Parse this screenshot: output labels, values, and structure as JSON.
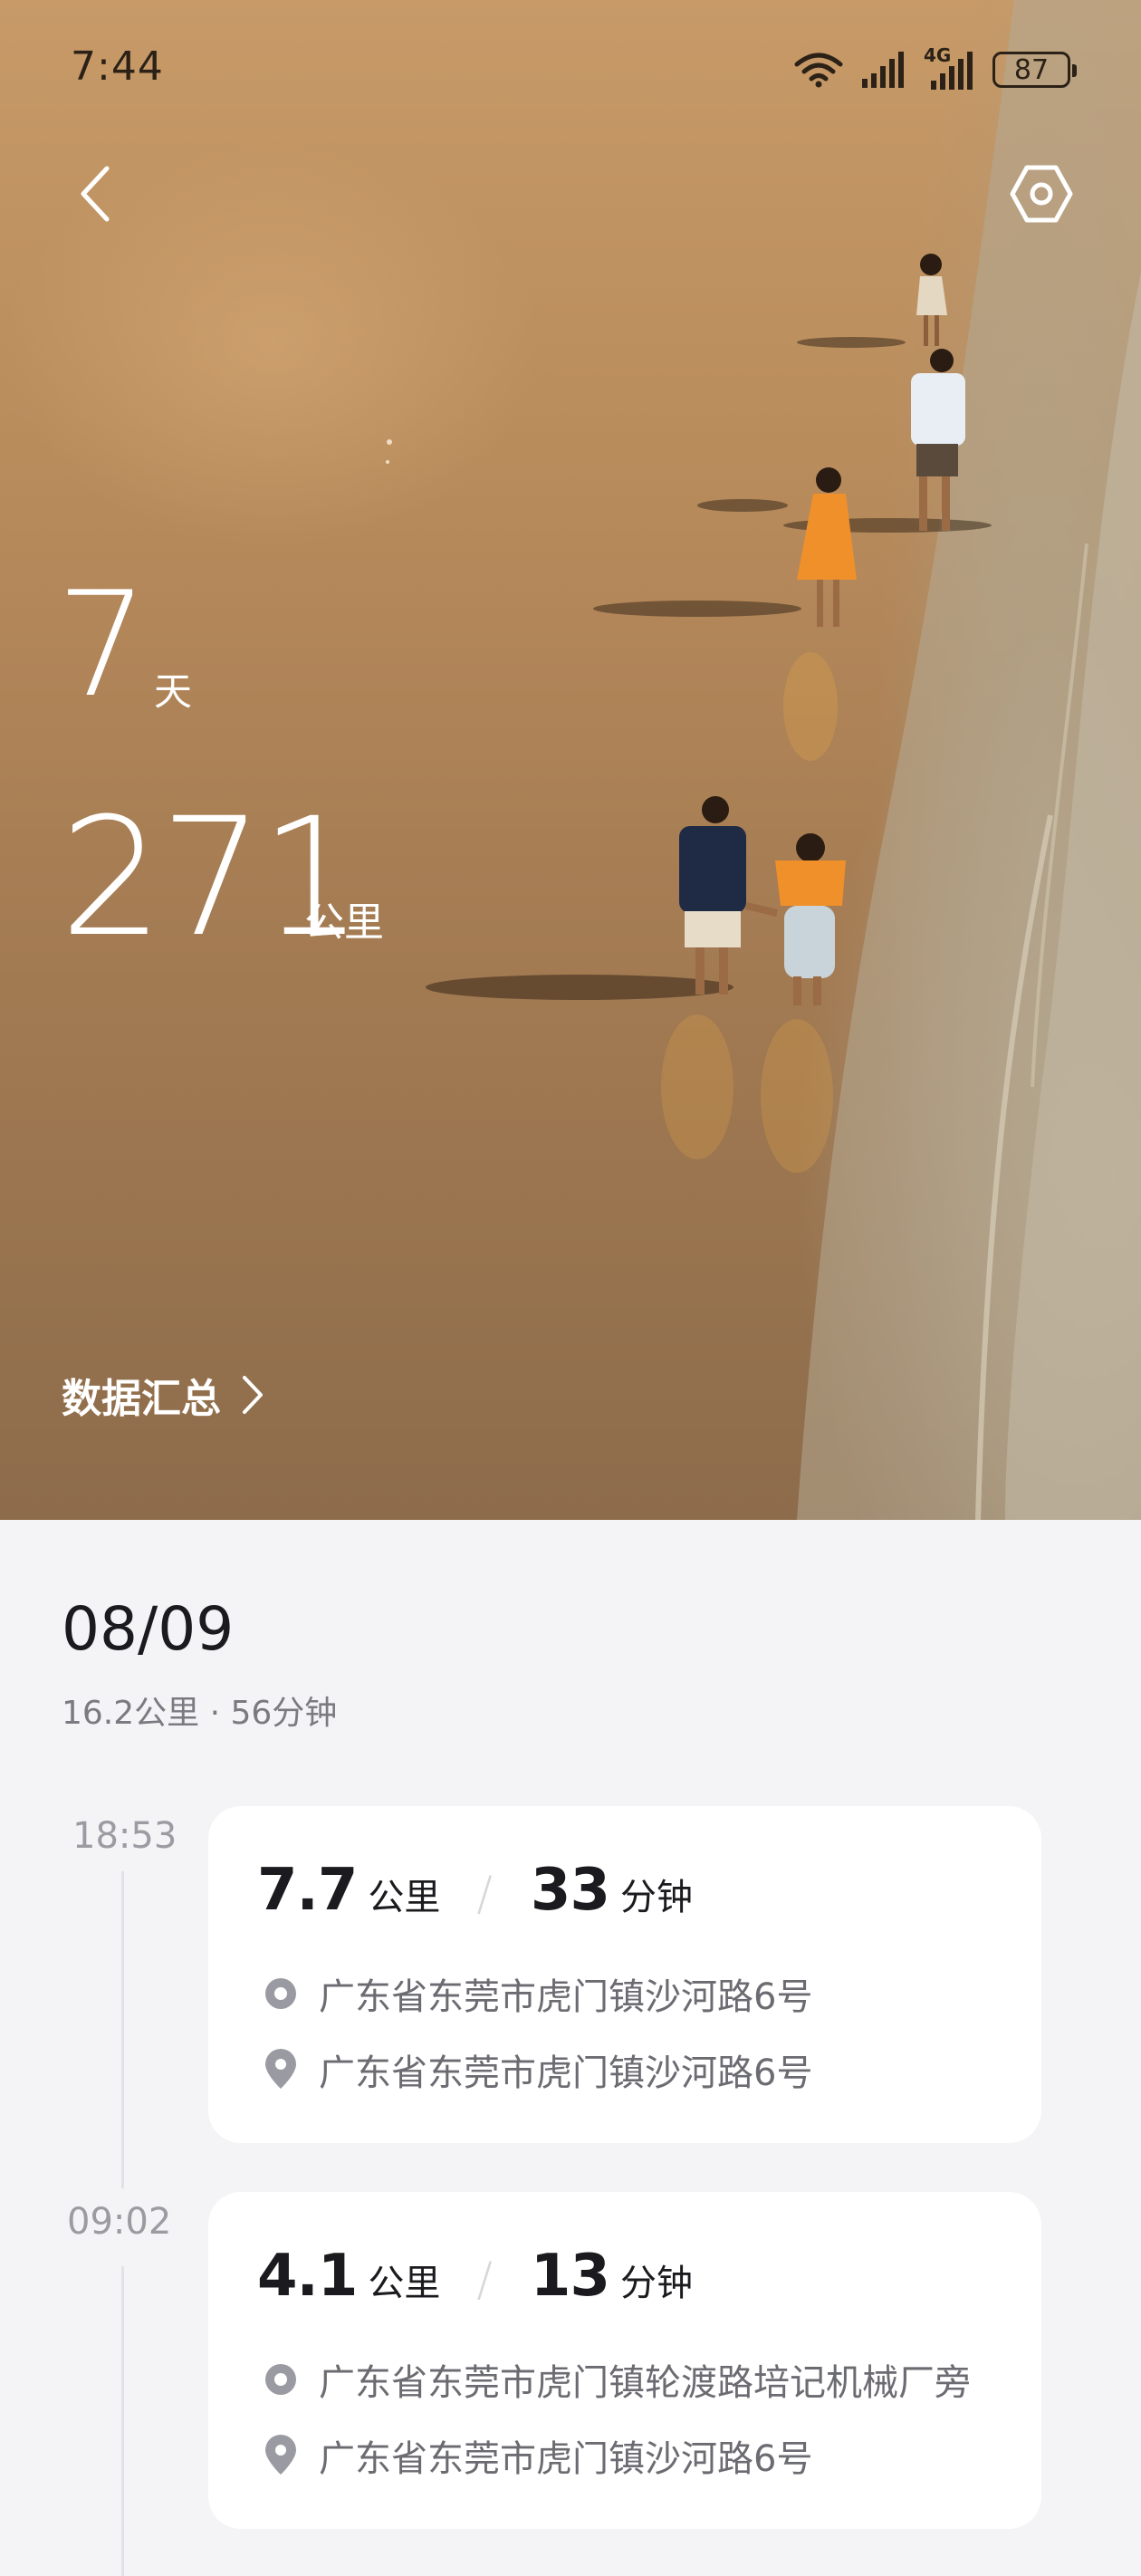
{
  "status_bar": {
    "time": "7:44",
    "network": "4G",
    "battery": "87"
  },
  "hero": {
    "days_value": "7",
    "days_unit": "天",
    "distance_value": "271",
    "distance_unit": "公里",
    "summary_link": "数据汇总"
  },
  "day": {
    "date": "08/09",
    "summary": "16.2公里 · 56分钟"
  },
  "trips": [
    {
      "time": "18:53",
      "distance": "7.7",
      "distance_unit": "公里",
      "duration": "33",
      "duration_unit": "分钟",
      "start": "广东省东莞市虎门镇沙河路6号",
      "end": "广东省东莞市虎门镇沙河路6号"
    },
    {
      "time": "09:02",
      "distance": "4.1",
      "distance_unit": "公里",
      "duration": "13",
      "duration_unit": "分钟",
      "start": "广东省东莞市虎门镇轮渡路培记机械厂旁",
      "end": "广东省东莞市虎门镇沙河路6号"
    }
  ],
  "colors": {
    "accent_text": "#1b1b1f",
    "muted_text": "#6b6b72",
    "card_bg": "#ffffff",
    "page_bg": "#f4f4f6"
  },
  "icons": [
    "wifi-icon",
    "signal-icon",
    "back-chevron-icon",
    "settings-hexagon-icon",
    "chevron-right-icon",
    "start-point-icon",
    "map-pin-icon"
  ]
}
